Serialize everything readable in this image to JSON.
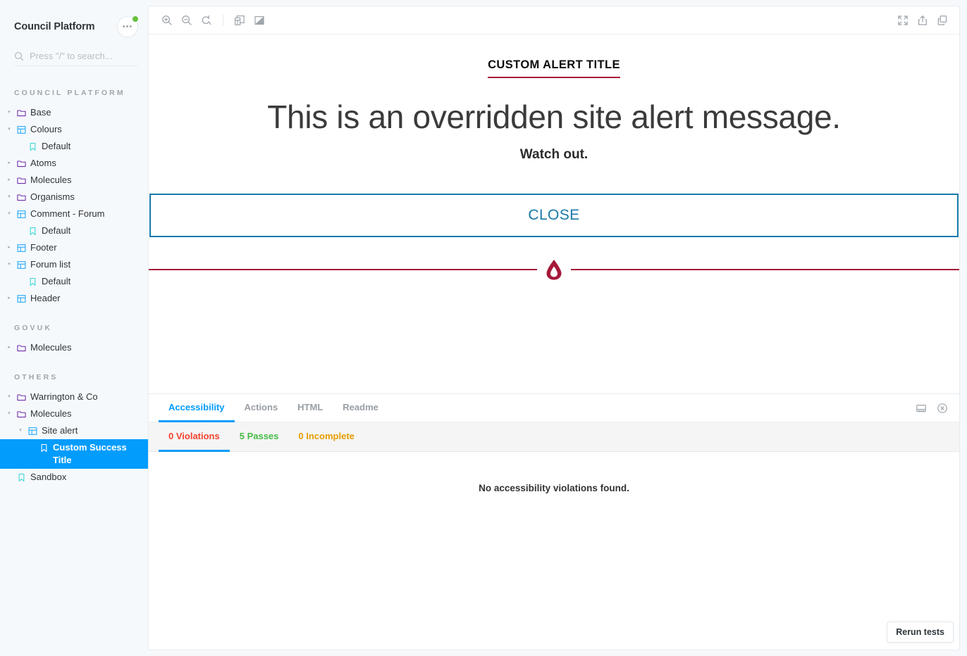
{
  "sidebar": {
    "title": "Council Platform",
    "menu_icon": "ellipsis-icon",
    "update_badge": true,
    "search": {
      "placeholder": "Press \"/\" to search...",
      "value": "",
      "icon": "search-icon"
    },
    "sections": [
      {
        "label": "Council Platform",
        "items": [
          {
            "label": "Base",
            "icon": "folder-icon",
            "depth": 0,
            "state": "open"
          },
          {
            "label": "Colours",
            "icon": "component-icon",
            "depth": 1,
            "state": "open"
          },
          {
            "label": "Default",
            "icon": "story-icon",
            "depth": 2,
            "state": "none"
          },
          {
            "label": "Atoms",
            "icon": "folder-icon",
            "depth": 0,
            "state": "closed"
          },
          {
            "label": "Molecules",
            "icon": "folder-icon",
            "depth": 0,
            "state": "closed"
          },
          {
            "label": "Organisms",
            "icon": "folder-icon",
            "depth": 0,
            "state": "open"
          },
          {
            "label": "Comment - Forum",
            "icon": "component-icon",
            "depth": 1,
            "state": "open"
          },
          {
            "label": "Default",
            "icon": "story-icon",
            "depth": 2,
            "state": "none"
          },
          {
            "label": "Footer",
            "icon": "component-icon",
            "depth": 1,
            "state": "closed"
          },
          {
            "label": "Forum list",
            "icon": "component-icon",
            "depth": 1,
            "state": "open"
          },
          {
            "label": "Default",
            "icon": "story-icon",
            "depth": 2,
            "state": "none"
          },
          {
            "label": "Header",
            "icon": "component-icon",
            "depth": 1,
            "state": "closed"
          }
        ]
      },
      {
        "label": "GOVUK",
        "items": [
          {
            "label": "Molecules",
            "icon": "folder-icon",
            "depth": 0,
            "state": "closed"
          }
        ]
      },
      {
        "label": "Others",
        "items": [
          {
            "label": "Warrington & Co",
            "icon": "folder-icon",
            "depth": 0,
            "state": "open"
          },
          {
            "label": "Molecules",
            "icon": "folder-icon",
            "depth": 1,
            "state": "open"
          },
          {
            "label": "Site alert",
            "icon": "component-icon",
            "depth": 2,
            "state": "open"
          },
          {
            "label": "Custom Success Title",
            "icon": "story-icon",
            "depth": 3,
            "state": "none",
            "selected": true
          },
          {
            "label": "Sandbox",
            "icon": "story-icon",
            "depth": 1,
            "state": "none"
          }
        ]
      }
    ]
  },
  "toolbar": {
    "left": [
      {
        "name": "zoom-in-icon",
        "title": "Zoom in"
      },
      {
        "name": "zoom-out-icon",
        "title": "Zoom out"
      },
      {
        "name": "zoom-reset-icon",
        "title": "Reset zoom"
      }
    ],
    "left2": [
      {
        "name": "grid-icon",
        "title": "Apply a grid to the preview"
      },
      {
        "name": "background-icon",
        "title": "Change the background of the preview"
      }
    ],
    "right": [
      {
        "name": "fullscreen-icon",
        "title": "Go full screen"
      },
      {
        "name": "share-icon",
        "title": "Open canvas in new tab"
      },
      {
        "name": "copy-icon",
        "title": "Copy canvas link"
      }
    ]
  },
  "preview": {
    "alert_title": "Custom Alert Title",
    "alert_message": "This is an overridden site alert message.",
    "alert_sub": "Watch out.",
    "close_label": "CLOSE",
    "divider_icon": "droplet-icon",
    "accent_red": "#A5193A",
    "accent_blue": "#1879A8"
  },
  "addons": {
    "tabs": [
      {
        "label": "Accessibility",
        "active": true
      },
      {
        "label": "Actions",
        "active": false
      },
      {
        "label": "HTML",
        "active": false
      },
      {
        "label": "Readme",
        "active": false
      }
    ],
    "panel_icons": [
      {
        "name": "dock-bottom-icon",
        "title": "Change addon orientation"
      },
      {
        "name": "close-panel-icon",
        "title": "Hide addons"
      }
    ],
    "accessibility": {
      "result_tabs": [
        {
          "label": "0 Violations",
          "color": "#F4432F",
          "active": true
        },
        {
          "label": "5 Passes",
          "color": "#44BB44",
          "active": false
        },
        {
          "label": "0 Incomplete",
          "color": "#E69D00",
          "active": false
        }
      ],
      "empty_message": "No accessibility violations found.",
      "rerun_label": "Rerun tests"
    }
  }
}
